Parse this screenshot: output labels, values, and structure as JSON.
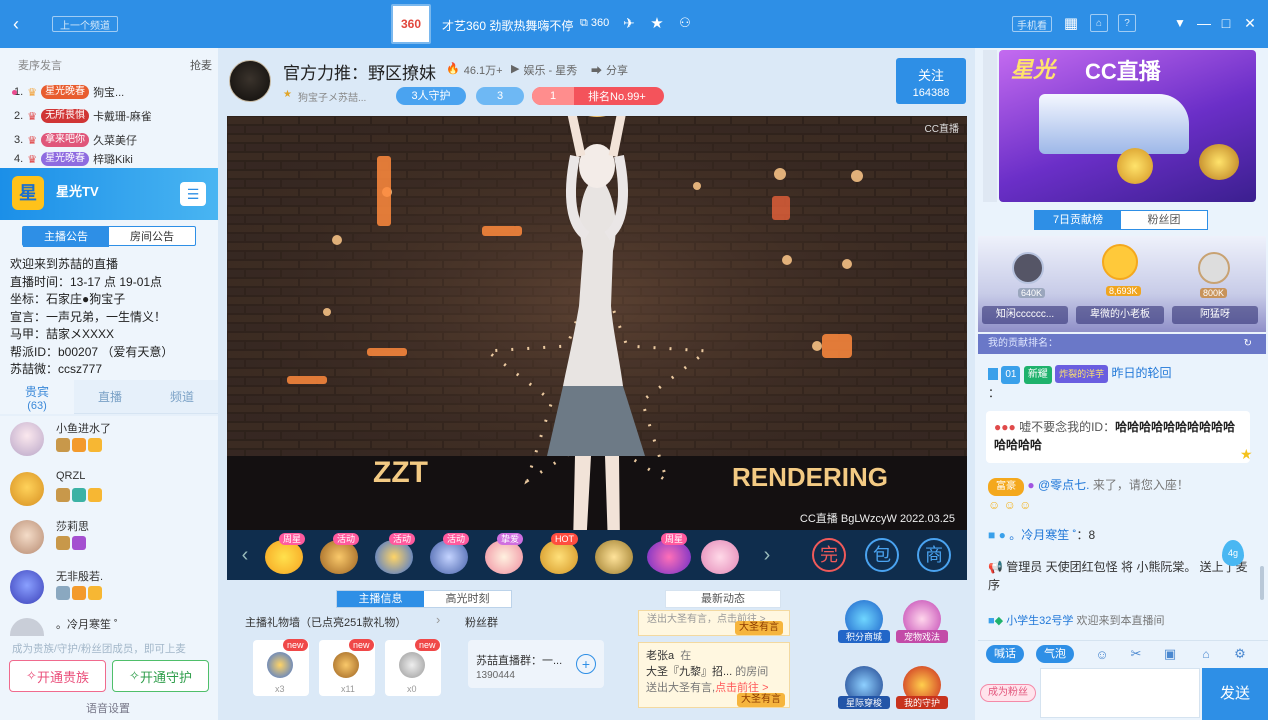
{
  "titlebar": {
    "back_icon": "chevron-left",
    "prev_channel": "上一个频道",
    "channel_logo": "360",
    "channel_title": "才艺360 劲歌热舞嗨不停",
    "channel_id": "360",
    "phone_watch": "手机看"
  },
  "left": {
    "top_bar": {
      "label": "麦序发言",
      "grab": "抢麦"
    },
    "ranks": [
      {
        "num": "1.",
        "medal": "星光晚春",
        "name": "狗宝..."
      },
      {
        "num": "2.",
        "medal": "无所畏惧",
        "name": "卡戴珊-麻雀"
      },
      {
        "num": "3.",
        "medal": "拿来吧你",
        "name": "久菜美仔"
      },
      {
        "num": "4.",
        "medal": "星光晚春",
        "name": "梓璐Kiki"
      }
    ],
    "channel_name": "星光TV",
    "channel_logo": "星",
    "notice_tabs": [
      "主播公告",
      "房间公告"
    ],
    "notice_lines": [
      "欢迎来到苏喆的直播",
      "直播时间：13-17 点 19-01点",
      "坐标：石家庄●狗宝子",
      "宣言：一声兄弟，一生情义！",
      "马甲：喆家メXXXX",
      "帮派ID：b00207 （爱有天意）",
      "苏喆微：ccsz777"
    ],
    "user_tabs": {
      "vip": "贵宾",
      "vip_count": "(63)",
      "live": "直播",
      "channel": "频道"
    },
    "users": [
      {
        "name": "小鱼进水了"
      },
      {
        "name": "QRZL"
      },
      {
        "name": "莎莉思"
      },
      {
        "name": "无非殷若."
      },
      {
        "name": "。冷月寒笙 ˚"
      }
    ],
    "member_note": "成为贵族/守护/粉丝团成员，即可上麦",
    "open_noble": "开通贵族",
    "open_guard": "开通守护",
    "voice_settings": "语音设置"
  },
  "streamer": {
    "title": "官方力推：野区撩妹",
    "heat": "46.1万+",
    "category": "娱乐 - 星秀",
    "share": "分享",
    "sub_name": "狗宝子メ苏喆...",
    "guard": "3人守护",
    "fans": "3",
    "rank_level": "1",
    "rank_text": "排名No.99+",
    "follow_label": "关注",
    "follow_count": "164388"
  },
  "video": {
    "watermark": "CC直播",
    "neon_left": "ZZT",
    "neon_right": "RENDERING",
    "stamp": "CC直播 BgLWzcyW 2022.03.25"
  },
  "gifts": {
    "items": [
      {
        "tag": "周星"
      },
      {
        "tag": "活动"
      },
      {
        "tag": "活动"
      },
      {
        "tag": "活动"
      },
      {
        "tag": "挚爱"
      },
      {
        "tag": "HOT"
      },
      {
        "tag": ""
      },
      {
        "tag": "周星"
      },
      {
        "tag": ""
      }
    ],
    "tools": [
      "完",
      "包",
      "商"
    ]
  },
  "info": {
    "tabs": [
      "主播信息",
      "高光时刻"
    ],
    "gift_wall": "主播礼物墙（已点亮251款礼物）",
    "gift_wall_items": [
      {
        "tag": "new",
        "count": "x3"
      },
      {
        "tag": "new",
        "count": "x11"
      },
      {
        "tag": "new",
        "count": "x0"
      }
    ],
    "fans_group": "粉丝群",
    "group_name": "苏喆直播群：一...",
    "group_id": "1390444",
    "dynamic_tab": "最新动态",
    "news1_line": "送出大圣有言，点击前往 >",
    "news1_badge": "大圣有言",
    "news2_user": "老张a",
    "news2_in": "在",
    "news2_line1": "大圣『九黎』招...",
    "news2_room": "的房间",
    "news2_line2": "送出大圣有言,",
    "news2_link": "点击前往 >",
    "news2_badge": "大圣有言",
    "act1": "积分商城",
    "act2": "宠物戏法",
    "act3": "星际穿梭",
    "act4": "我的守护"
  },
  "right": {
    "banner_logo": "CC直播",
    "banner_title": "星光",
    "tabs": [
      "7日贡献榜",
      "粉丝团"
    ],
    "podium": [
      {
        "name": "知闲cccccc...",
        "score": "640K"
      },
      {
        "name": "卑微的小老板",
        "score": "8,693K"
      },
      {
        "name": "阿猛呀",
        "score": "800K"
      }
    ],
    "my_rank": "我的贡献排名：",
    "chat": [
      {
        "badge": "01",
        "tag": "新耀",
        "medal": "炸裂的洋芋",
        "name": "昨日的轮回",
        "text": "："
      },
      {
        "name": "",
        "text": "嘘不要念我的ID：",
        "highlight": "哈哈哈哈哈哈哈哈哈哈哈哈哈哈"
      },
      {
        "name": "@零点七.",
        "text": "来了，请您入座！",
        "tag": "富豪"
      },
      {
        "name": "。冷月寒笙 ˚",
        "text": "：8"
      },
      {
        "name": "管理员",
        "text": "天使团红包怪 将 小熊阮棠。 送上了麦序"
      },
      {
        "name": "小学生32号学",
        "text": "欢迎来到本直播间"
      }
    ],
    "tools": {
      "call": "喊话",
      "bubble": "气泡"
    },
    "fans_btn": "成为粉丝",
    "send": "发送",
    "water": "4g"
  }
}
